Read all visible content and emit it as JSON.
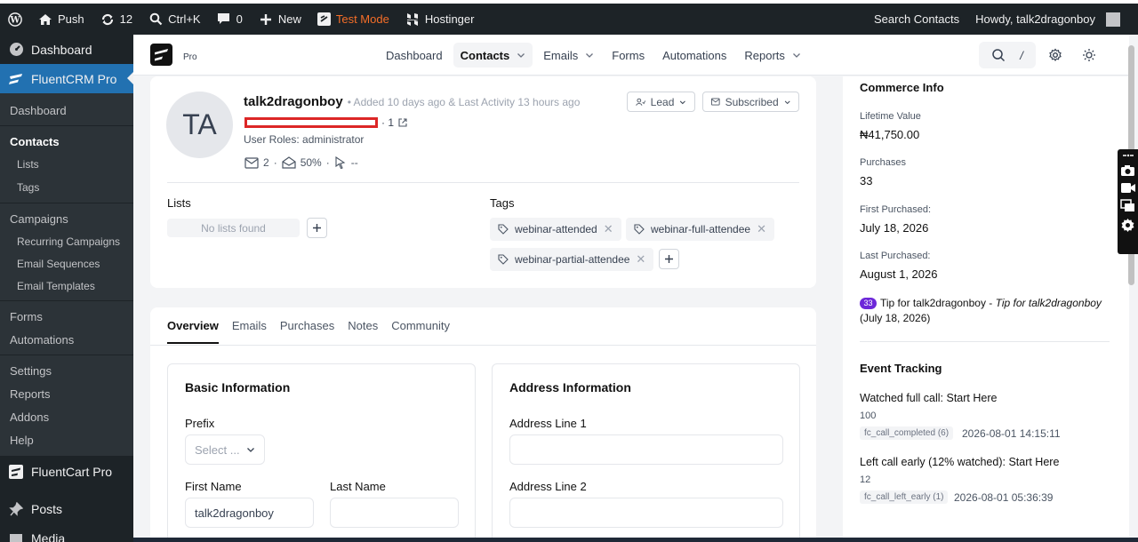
{
  "adminbar": {
    "site": "Push",
    "updates": "12",
    "shortcut": "Ctrl+K",
    "comments": "0",
    "new": "New",
    "test_mode": "Test Mode",
    "hostinger": "Hostinger",
    "search_contacts": "Search Contacts",
    "howdy": "Howdy, talk2dragonboy"
  },
  "menu": {
    "dashboard": "Dashboard",
    "fluentcrm": "FluentCRM Pro",
    "sub": {
      "dashboard": "Dashboard",
      "contacts": "Contacts",
      "lists": "Lists",
      "tags": "Tags",
      "campaigns": "Campaigns",
      "recurring": "Recurring Campaigns",
      "sequences": "Email Sequences",
      "templates": "Email Templates",
      "forms": "Forms",
      "automations": "Automations",
      "settings": "Settings",
      "reports": "Reports",
      "addons": "Addons",
      "help": "Help"
    },
    "fluentcart": "FluentCart Pro",
    "posts": "Posts",
    "media": "Media"
  },
  "topnav": {
    "pro": "Pro",
    "items": [
      "Dashboard",
      "Contacts",
      "Emails",
      "Forms",
      "Automations",
      "Reports"
    ],
    "slash": "/"
  },
  "contact": {
    "initials": "TA",
    "name": "talk2dragonboy",
    "meta": "• Added 10 days ago & Last Activity 13 hours ago",
    "email_suffix": "· 1",
    "roles": "User Roles: administrator",
    "emails_sent": "2",
    "open_rate": "50%",
    "clicks": "--",
    "status_type": "Lead",
    "status": "Subscribed",
    "lists_label": "Lists",
    "no_lists": "No lists found",
    "tags_label": "Tags",
    "tags": [
      "webinar-attended",
      "webinar-full-attendee",
      "webinar-partial-attendee"
    ]
  },
  "tabs": [
    "Overview",
    "Emails",
    "Purchases",
    "Notes",
    "Community"
  ],
  "basic": {
    "title": "Basic Information",
    "prefix_label": "Prefix",
    "prefix_placeholder": "Select ...",
    "first_name_label": "First Name",
    "first_name": "talk2dragonboy",
    "last_name_label": "Last Name",
    "last_name": ""
  },
  "address": {
    "title": "Address Information",
    "line1_label": "Address Line 1",
    "line1": "",
    "line2_label": "Address Line 2",
    "line2": ""
  },
  "commerce": {
    "title": "Commerce Info",
    "lifetime_label": "Lifetime Value",
    "lifetime": "₦41,750.00",
    "purchases_label": "Purchases",
    "purchases": "33",
    "first_label": "First Purchased:",
    "first": "July 18, 2026",
    "last_label": "Last Purchased:",
    "last": "August 1, 2026",
    "tip_badge": "33",
    "tip_text": "Tip for talk2dragonboy - ",
    "tip_italic": "Tip for talk2dragonboy",
    "tip_date": "(July 18, 2026)"
  },
  "events": {
    "title": "Event Tracking",
    "items": [
      {
        "name": "Watched full call: Start Here",
        "value": "100",
        "tag": "fc_call_completed (6)",
        "time": "2026-08-01 14:15:11"
      },
      {
        "name": "Left call early (12% watched): Start Here",
        "value": "12",
        "tag": "fc_call_left_early (1)",
        "time": "2026-08-01 05:36:39"
      }
    ]
  },
  "colors": {
    "accent": "#2271b1",
    "adminbar": "#1d2327",
    "badge": "#6d28d9",
    "test_mode": "#f56e28"
  }
}
